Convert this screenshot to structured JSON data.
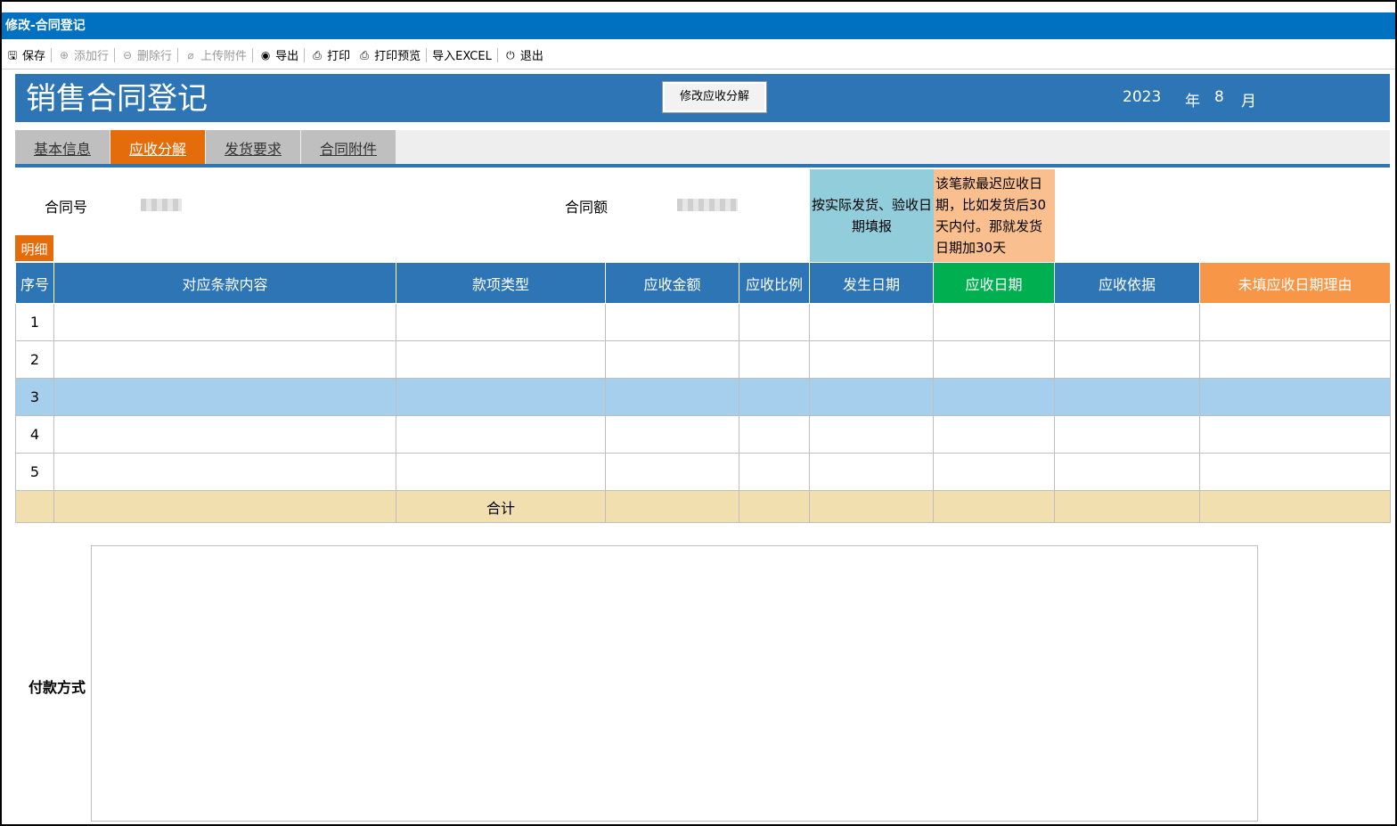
{
  "window": {
    "title": "修改-合同登记"
  },
  "toolbar": {
    "buttons": [
      {
        "label": "保存",
        "icon": "save-icon",
        "enabled": true
      },
      {
        "label": "添加行",
        "icon": "add-circle-icon",
        "enabled": false
      },
      {
        "label": "删除行",
        "icon": "remove-circle-icon",
        "enabled": false
      },
      {
        "label": "上传附件",
        "icon": "paperclip-icon",
        "enabled": false
      },
      {
        "label": "导出",
        "icon": "export-icon",
        "enabled": true
      },
      {
        "label": "打印",
        "icon": "printer-icon",
        "enabled": true
      },
      {
        "label": "打印预览",
        "icon": "print-preview-icon",
        "enabled": true
      },
      {
        "label": "导入EXCEL",
        "icon": "",
        "enabled": true
      },
      {
        "label": "退出",
        "icon": "power-icon",
        "enabled": true
      }
    ]
  },
  "header": {
    "title": "销售合同登记",
    "modify_button": "修改应收分解",
    "year": "2023",
    "year_unit": "年",
    "month": "8",
    "month_unit": "月"
  },
  "tabs": [
    {
      "label": "基本信息",
      "active": false
    },
    {
      "label": "应收分解",
      "active": true
    },
    {
      "label": "发货要求",
      "active": false
    },
    {
      "label": "合同附件",
      "active": false
    }
  ],
  "form": {
    "contract_no_label": "合同号",
    "contract_amount_label": "合同额"
  },
  "notes": {
    "blue": "按实际发货、验收日期填报",
    "orange": "该笔款最迟应收日期，比如发货后30天内付。那就发货日期加30天"
  },
  "detail_tag": "明细",
  "table": {
    "columns": [
      "序号",
      "对应条款内容",
      "款项类型",
      "应收金额",
      "应收比例",
      "发生日期",
      "应收日期",
      "应收依据",
      "未填应收日期理由"
    ],
    "rows": [
      "1",
      "2",
      "3",
      "4",
      "5"
    ],
    "selected_row": "3",
    "total_label": "合计"
  },
  "payment": {
    "label": "付款方式"
  },
  "colors": {
    "title_bar": "#0070c0",
    "header": "#2e75b6",
    "active_tab": "#e46c0a",
    "green_header": "#00b050",
    "orange_header": "#f79646",
    "selected_row": "#a6cfee",
    "total_row": "#f2dfb0"
  }
}
